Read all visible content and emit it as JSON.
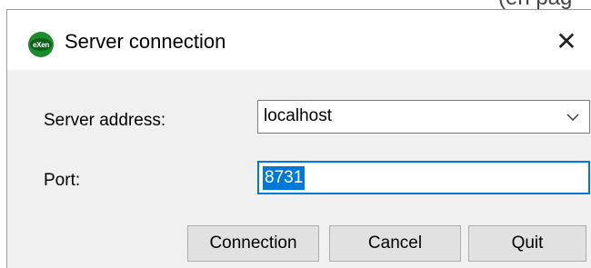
{
  "background": {
    "fragment_text": "(en pag"
  },
  "window": {
    "title": "Server connection",
    "icon": "app-logo-icon",
    "icon_text": "eXen",
    "close_glyph": "✕"
  },
  "form": {
    "server_address_label": "Server address:",
    "server_address_value": "localhost",
    "port_label": "Port:",
    "port_value": "8731"
  },
  "buttons": {
    "connection_label": "Connection",
    "cancel_label": "Cancel",
    "quit_label": "Quit"
  },
  "colors": {
    "selection": "#0078d7",
    "dialog_bg": "#f0f0f0",
    "button_bg": "#e1e1e1",
    "icon_green": "#1e8a2e"
  }
}
